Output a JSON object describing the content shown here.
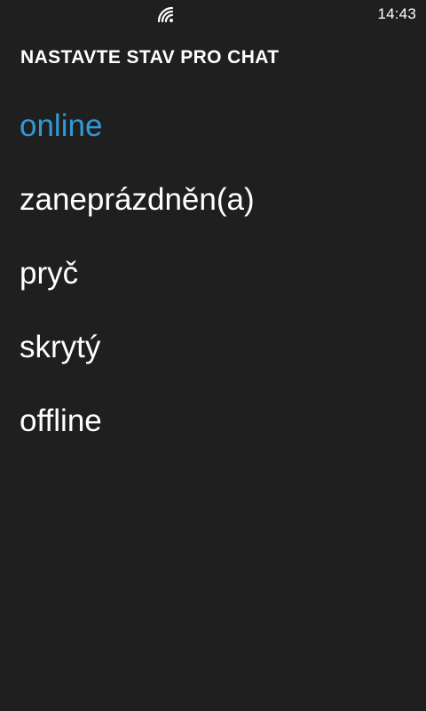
{
  "status_bar": {
    "signal_icon": "wifi-signal-icon",
    "time": "14:43"
  },
  "header": {
    "title": "NASTAVTE STAV PRO CHAT"
  },
  "options": [
    {
      "label": "online",
      "selected": true
    },
    {
      "label": "zaneprázdněn(a)",
      "selected": false
    },
    {
      "label": "pryč",
      "selected": false
    },
    {
      "label": "skrytý",
      "selected": false
    },
    {
      "label": "offline",
      "selected": false
    }
  ],
  "colors": {
    "background": "#1f1f1f",
    "text": "#ffffff",
    "accent": "#2e9ad8"
  }
}
